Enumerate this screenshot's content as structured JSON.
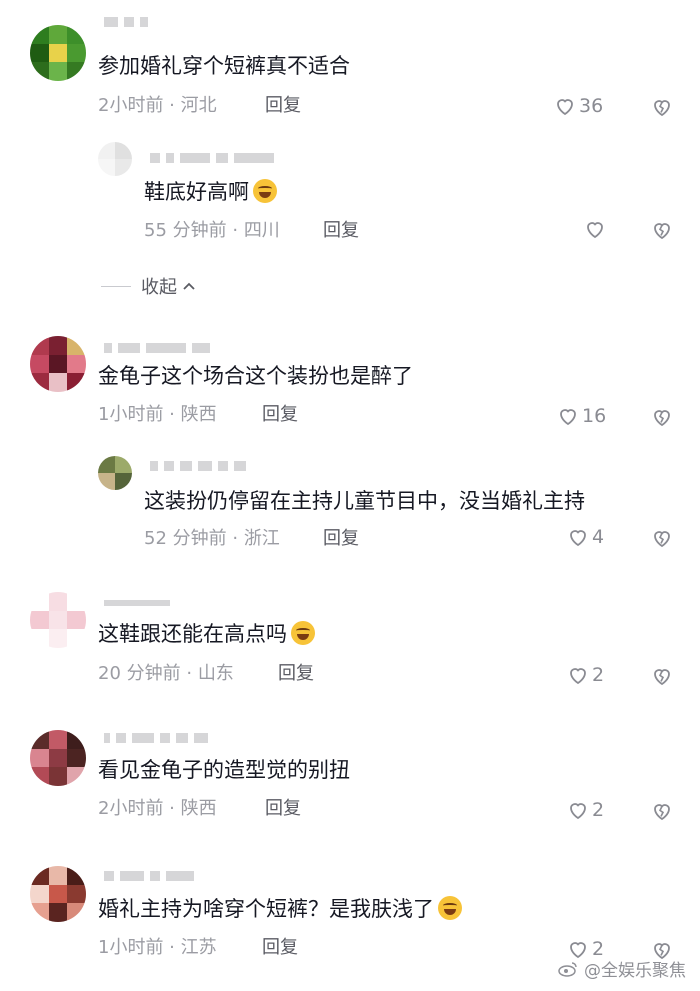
{
  "comments": [
    {
      "text": "参加婚礼穿个短裤真不适合",
      "time": "2小时前",
      "location": "河北",
      "reply_label": "回复",
      "likes": "36",
      "avatar_colors": [
        "#2e7d1f",
        "#5fa83a",
        "#3d8f2a",
        "#1f5c12",
        "#e8d24a",
        "#4a9a30",
        "#2d6d1c",
        "#6bb44a",
        "#357a22"
      ],
      "replies": [
        {
          "text": "鞋底好高啊",
          "emoji": "rofl-emoji",
          "time": "55 分钟前",
          "location": "四川",
          "reply_label": "回复",
          "likes": "",
          "avatar_colors": [
            "#f1f1f1",
            "#e0e0e0",
            "#f6f6f6",
            "#e9e9e9"
          ]
        }
      ]
    },
    {
      "text": "金龟子这个场合这个装扮也是醉了",
      "time": "1小时前",
      "location": "陕西",
      "reply_label": "回复",
      "likes": "16",
      "avatar_colors": [
        "#b03a4e",
        "#7a2031",
        "#d8b46a",
        "#c64a62",
        "#5a1624",
        "#e27a8a",
        "#9c2b40",
        "#e9c0c6",
        "#8a1e33"
      ],
      "replies": [
        {
          "text": "这装扮仍停留在主持儿童节目中，没当婚礼主持",
          "emoji": "",
          "time": "52 分钟前",
          "location": "浙江",
          "reply_label": "回复",
          "likes": "4",
          "avatar_colors": [
            "#6b7a44",
            "#9caa6a",
            "#c7b48a",
            "#55643a"
          ]
        }
      ]
    },
    {
      "text": "这鞋跟还能在高点吗",
      "emoji": "cry-laugh-emoji",
      "time": "20 分钟前",
      "location": "山东",
      "reply_label": "回复",
      "likes": "2",
      "avatar_colors": [
        "#ffffff",
        "#f7dde3",
        "#ffffff",
        "#f3c9d2",
        "#f8e3e8",
        "#f3c9d2",
        "#ffffff",
        "#fbeef1",
        "#ffffff"
      ],
      "replies": []
    },
    {
      "text": "看见金龟子的造型觉的别扭",
      "time": "2小时前",
      "location": "陕西",
      "reply_label": "回复",
      "likes": "2",
      "avatar_colors": [
        "#5a2c2a",
        "#c25a66",
        "#3e1d1c",
        "#d98590",
        "#8d3b44",
        "#4c2422",
        "#b24a56",
        "#7a3436",
        "#e0a4ab"
      ],
      "replies": []
    },
    {
      "text": "婚礼主持为啥穿个短裤？是我肤浅了",
      "emoji": "grin-emoji",
      "time": "1小时前",
      "location": "江苏",
      "reply_label": "回复",
      "likes": "2",
      "avatar_colors": [
        "#6b2a22",
        "#e8b8a8",
        "#4a1d18",
        "#f4d6cc",
        "#c8584a",
        "#8a3a30",
        "#e6a090",
        "#5a2420",
        "#d88a7a"
      ],
      "replies": []
    }
  ],
  "collapse_label": "收起",
  "watermark": "@全娱乐聚焦",
  "icons": {
    "like": "heart-icon",
    "dislike": "broken-heart-icon",
    "collapse": "chevron-up-icon",
    "watermark": "weibo-icon"
  }
}
